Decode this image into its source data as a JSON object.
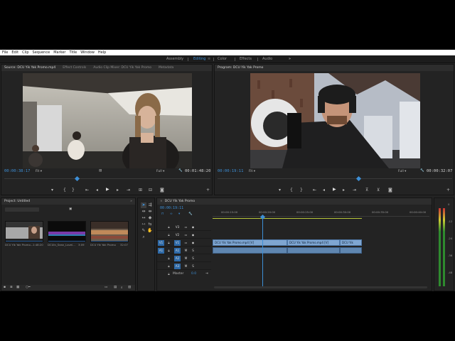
{
  "menu": [
    "File",
    "Edit",
    "Clip",
    "Sequence",
    "Marker",
    "Title",
    "Window",
    "Help"
  ],
  "workspaces": {
    "items": [
      "Assembly",
      "Editing",
      "Color",
      "Effects",
      "Audio"
    ],
    "active": "Editing",
    "more": "»"
  },
  "source": {
    "tabs": [
      "Source: DCU Yik Yak Promo.mp4",
      "Effect Controls",
      "Audio Clip Mixer: DCU Yik Yak Promo",
      "Metadata"
    ],
    "timecode": "00:00:38:17",
    "zoom": "Fit",
    "quality": "Full",
    "duration": "00:01:48:20"
  },
  "program": {
    "tab": "Program: DCU Yik Yak Promo",
    "timecode": "00:00:19:11",
    "zoom": "Fit",
    "quality": "Full",
    "duration": "00:00:32:07"
  },
  "project": {
    "tab": "Project: Untitled",
    "items": [
      {
        "name": "DCU Yik Yak Promo...",
        "duration": "1:48:20"
      },
      {
        "name": "DCUIn_Sean_Lovel...",
        "duration": "3:09"
      },
      {
        "name": "DCU Yik Yak Promo",
        "duration": "32:07"
      }
    ]
  },
  "timeline": {
    "tab": "DCU Yik Yak Promo",
    "timecode": "00:00:19:11",
    "ruler": [
      "00:00:15:00",
      "00:00:20:00",
      "00:00:25:00",
      "00:00:30:00",
      "00:00:35:00",
      "00:00:40:00"
    ],
    "video_tracks": [
      "V3",
      "V2",
      "V1"
    ],
    "audio_tracks": [
      "A1",
      "A2",
      "A3"
    ],
    "master": {
      "label": "Master",
      "value": "0.0"
    },
    "clips": [
      {
        "label": "DCU Yik Yak Promo.mp4 [V]"
      },
      {
        "label": "DCU Yik Yak Promo.mp4 [V]"
      },
      {
        "label": "DCU Yik"
      }
    ]
  },
  "meter": {
    "db_labels": [
      "0",
      "-12",
      "-24",
      "-36",
      "-48"
    ]
  }
}
